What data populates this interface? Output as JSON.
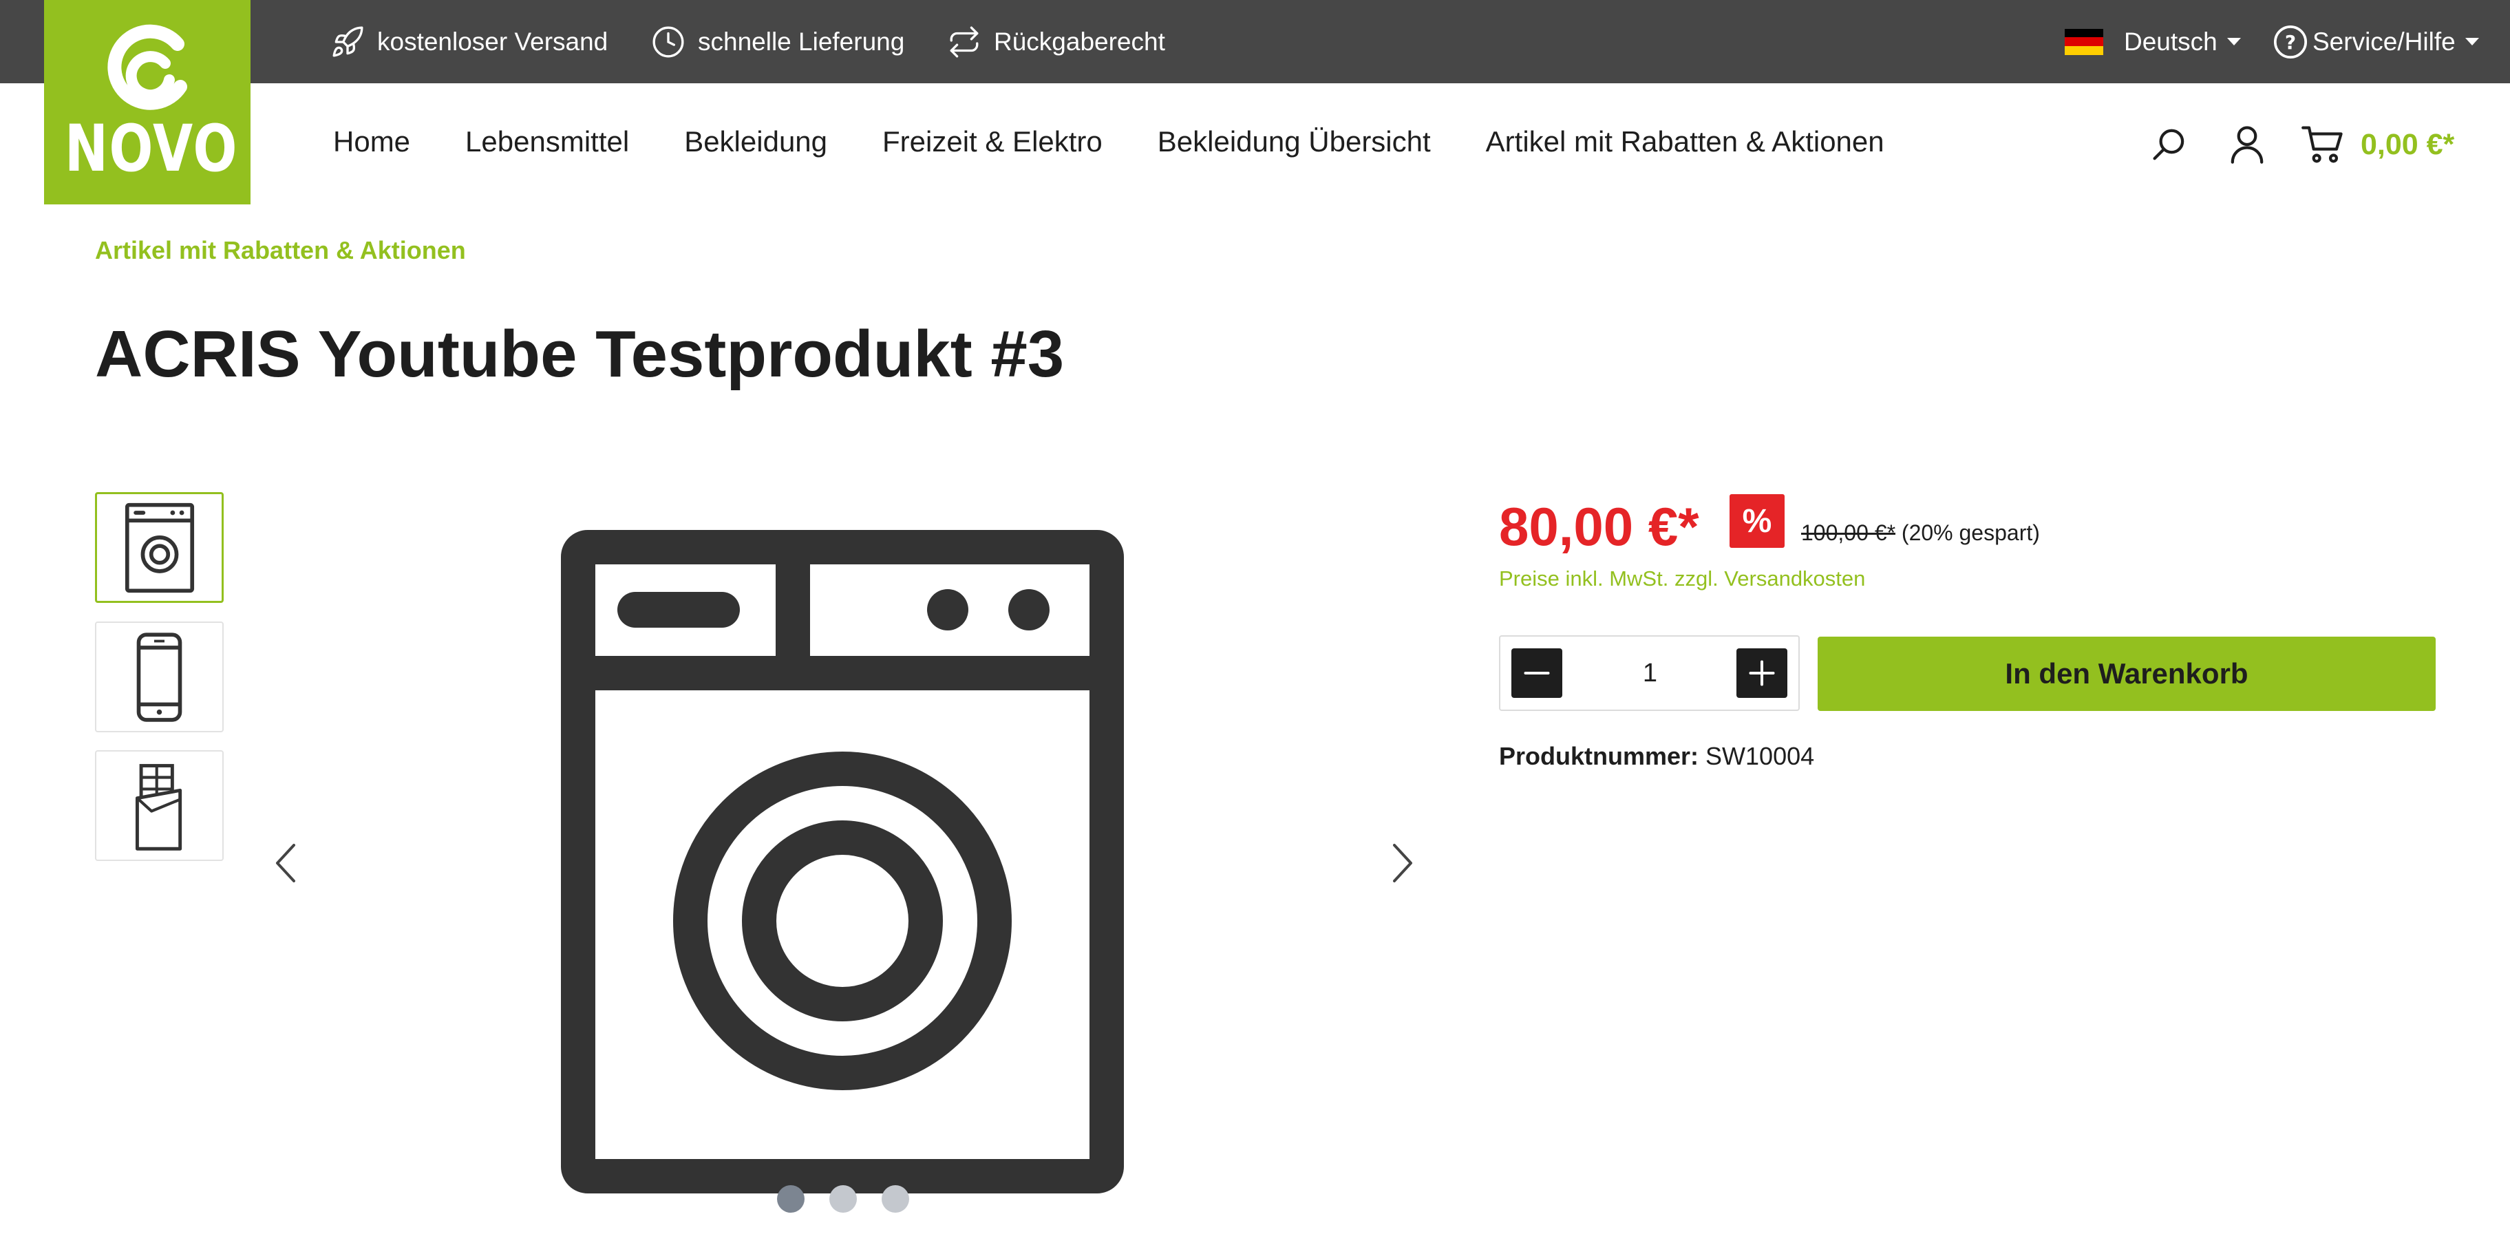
{
  "colors": {
    "brand_green": "#93c01f",
    "topbar_bg": "#474747",
    "price_red": "#e52427",
    "text_dark": "#1e1e1e"
  },
  "topbar": {
    "usps": [
      {
        "icon": "rocket-icon",
        "label": "kostenloser Versand"
      },
      {
        "icon": "clock-icon",
        "label": "schnelle Lieferung"
      },
      {
        "icon": "return-arrows-icon",
        "label": "Rückgaberecht"
      }
    ],
    "language": {
      "icon": "germany-flag-icon",
      "label": "Deutsch"
    },
    "service": {
      "icon": "help-circle-icon",
      "label": "Service/Hilfe"
    }
  },
  "logo": {
    "text": "NOVO"
  },
  "nav": {
    "items": [
      "Home",
      "Lebensmittel",
      "Bekleidung",
      "Freizeit & Elektro",
      "Bekleidung Übersicht",
      "Artikel mit Rabatten & Aktionen"
    ]
  },
  "header_actions": {
    "search_icon": "search-icon",
    "account_icon": "user-icon",
    "cart_icon": "cart-icon",
    "cart_total": "0,00 €*"
  },
  "breadcrumb": "Artikel mit Rabatten & Aktionen",
  "product": {
    "title": "ACRIS Youtube Testprodukt #3",
    "thumbnails": [
      {
        "icon": "washing-machine-icon",
        "active": true
      },
      {
        "icon": "smartphone-icon",
        "active": false
      },
      {
        "icon": "chocolate-bar-icon",
        "active": false
      }
    ],
    "main_image_icon": "washing-machine-icon",
    "slider_dots": 3,
    "slider_active_index": 0,
    "price": "80,00 €*",
    "discount_badge": "%",
    "old_price": "100,00 €*",
    "savings": "(20% gespart)",
    "tax_note": "Preise inkl. MwSt. zzgl. Versandkosten",
    "quantity": "1",
    "add_to_cart_label": "In den Warenkorb",
    "product_number_label": "Produktnummer:",
    "product_number": "SW10004"
  }
}
